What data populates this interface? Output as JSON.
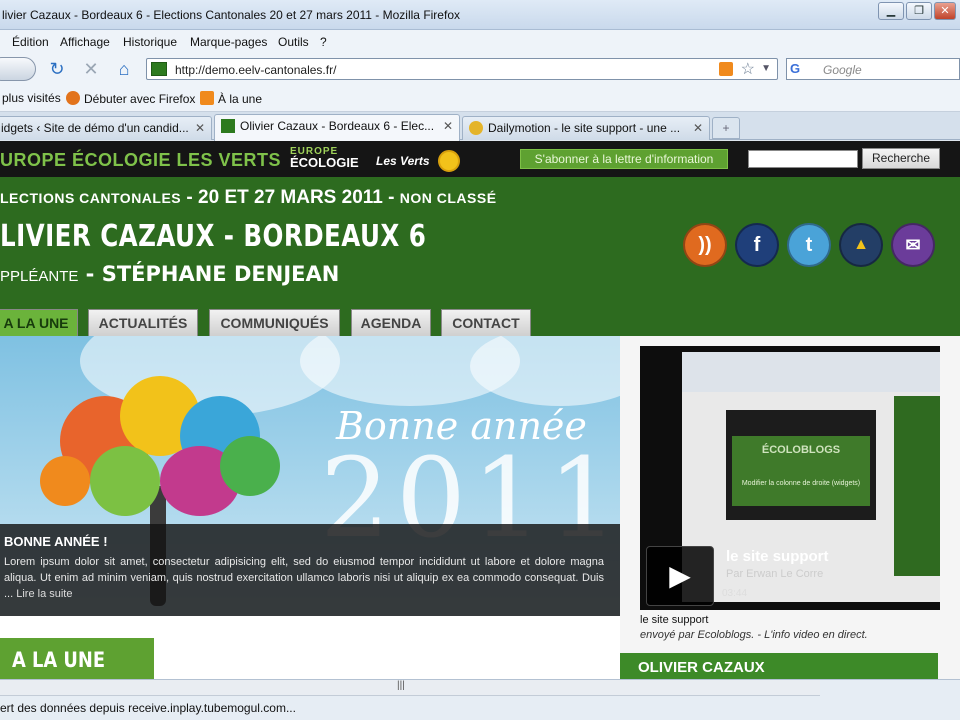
{
  "window": {
    "title": "livier Cazaux - Bordeaux 6 - Elections Cantonales 20 et 27 mars 2011 - Mozilla Firefox",
    "minimize": "▁",
    "maximize": "❐",
    "close": "✕"
  },
  "menu": [
    "Édition",
    "Affichage",
    "Historique",
    "Marque-pages",
    "Outils",
    "?"
  ],
  "nav": {
    "url": "http://demo.eelv-cantonales.fr/",
    "search_placeholder": "Google",
    "search_engine": "G"
  },
  "bookmarks": {
    "most_visited": "plus visités",
    "getting_started": "Débuter avec Firefox",
    "headlines": "À la une"
  },
  "tabs": [
    {
      "label": "idgets ‹ Site de démo d'un candid...",
      "active": false
    },
    {
      "label": "Olivier Cazaux - Bordeaux 6 - Elec...",
      "active": true
    },
    {
      "label": "Dailymotion - le site support - une ...",
      "active": false
    }
  ],
  "site": {
    "brand": "UROPE ÉCOLOGIE LES VERTS",
    "logo_top": "EUROPE",
    "logo_bottom": "ÉCOLOGIE",
    "logo_side": "Les Verts",
    "subscribe": "S'abonner à la lettre d'information",
    "search_button": "Recherche",
    "election_prefix": "LECTIONS CANTONALES",
    "sep1": " - ",
    "election_dates": "20 ET 27 MARS 2011",
    "sep2": " - ",
    "category": "NON CLASSÉ",
    "candidate": "LIVIER CAZAUX - BORDEAUX 6",
    "substitute_label": "PPLÉANTE",
    "sep3": " - ",
    "substitute_name": "STÉPHANE DENJEAN",
    "social": {
      "rss": "))",
      "facebook": "f",
      "twitter": "t",
      "ecolo": "▲",
      "mail": "✉"
    },
    "tabs": [
      "A LA UNE",
      "ACTUALITÉS",
      "COMMUNIQUÉS",
      "AGENDA",
      "CONTACT"
    ]
  },
  "feature": {
    "greeting": "Bonne année",
    "year": "2011",
    "headline": "BONNE ANNÉE !",
    "body": "Lorem ipsum dolor sit amet, consectetur adipisicing elit, sed do eiusmod tempor incididunt ut labore et dolore magna aliqua. Ut enim ad minim veniam, quis nostrud exercitation ullamco laboris nisi ut aliquip ex ea commodo consequat. Duis ...",
    "read_more": "Lire la suite",
    "section": "A LA UNE"
  },
  "video": {
    "inner_brand": "ÉCOLOBLOGS",
    "inner_text": "Modifier la colonne de droite (widgets)",
    "title": "le site support",
    "author": "Par Erwan Le Corre",
    "duration": "03:44",
    "caption_title": "le site support",
    "caption_sub": "envoyé par Ecoloblogs. - L'info video en direct.",
    "play": "▶"
  },
  "sidebar_heading": "OLIVIER CAZAUX",
  "status": {
    "text": "ert des données depuis receive.inplay.tubemogul.com...",
    "grip": "|||"
  },
  "colors": {
    "site_green": "#2d6b1f",
    "accent_green": "#5ea131",
    "rss": "#e06a1f",
    "facebook": "#1f3f7a",
    "twitter": "#4aa3d8",
    "ecolo": "#233e66",
    "mail": "#6b3c9a"
  }
}
